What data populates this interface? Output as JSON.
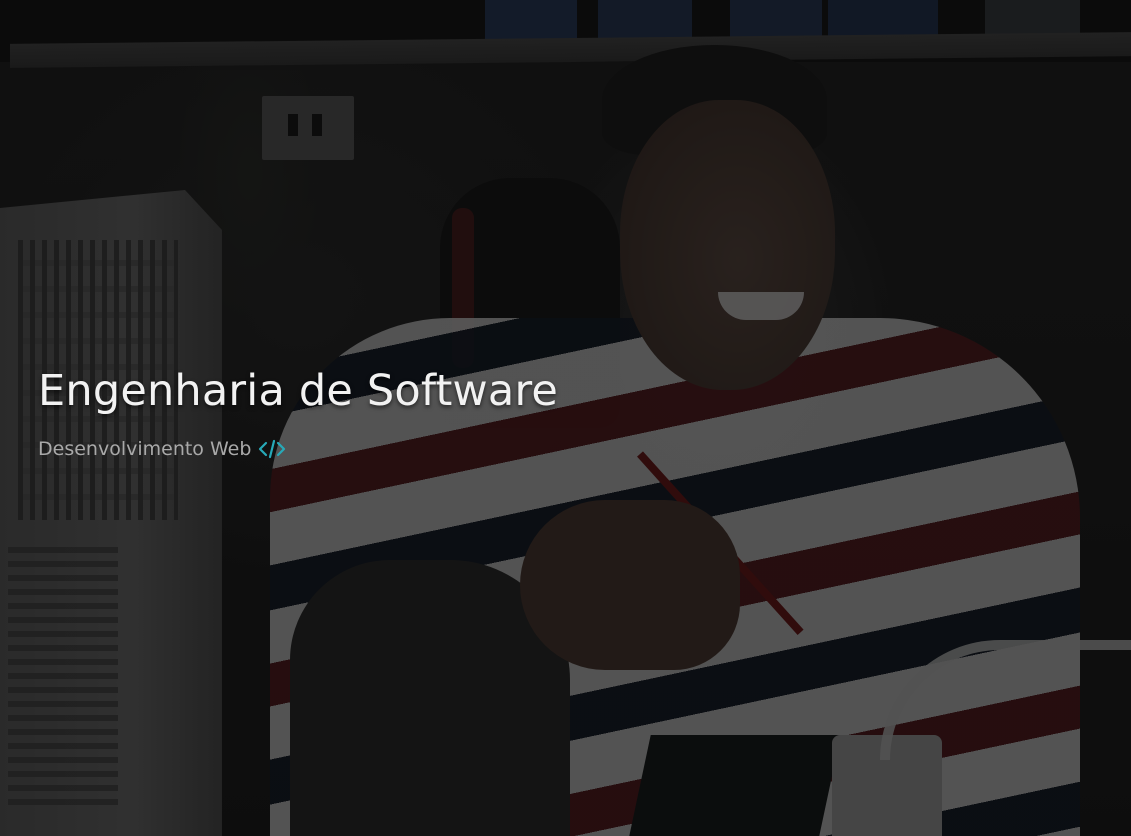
{
  "hero": {
    "title": "Engenharia de Software",
    "subtitle": "Desenvolvimento Web",
    "subtitle_icon": "code-icon",
    "accent_color": "#27a9b8",
    "background_image": "photo of smiling man in striped sweater at a desk with a PC case"
  }
}
